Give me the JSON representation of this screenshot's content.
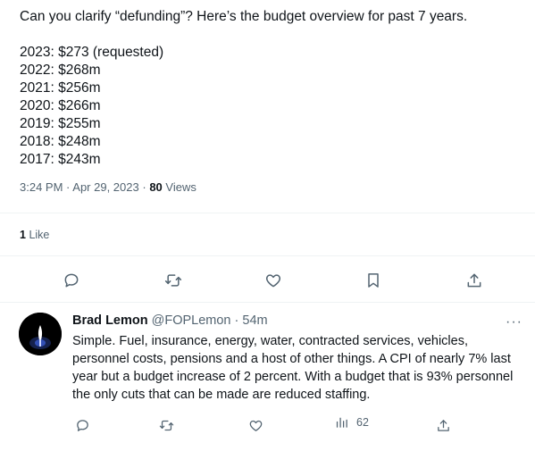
{
  "tweet": {
    "intro": "Can you clarify “defunding”? Here’s the budget overview for past 7 years.",
    "budget_lines": [
      "2023: $273 (requested)",
      "2022: $268m",
      "2021: $256m",
      "2020: $266m",
      "2019: $255m",
      "2018: $248m",
      "2017: $243m"
    ],
    "time": "3:24 PM",
    "date": "Apr 29, 2023",
    "views_count": "80",
    "views_label": "Views",
    "likes_count": "1",
    "likes_label": "Like"
  },
  "actions": [
    "reply-icon",
    "retweet-icon",
    "heart-icon",
    "bookmark-icon",
    "share-icon"
  ],
  "reply": {
    "name": "Brad Lemon",
    "handle": "@FOPLemon",
    "time": "54m",
    "more": "···",
    "text": "Simple. Fuel, insurance, energy, water, contracted services, vehicles, personnel costs, pensions and a host of other things. A CPI of nearly 7% last year but a budget increase of 2 percent. With a budget that is 93% personnel the only cuts that can be made are reduced staffing.",
    "views": "62"
  },
  "colors": {
    "text": "#0f1419",
    "muted": "#536471",
    "divider": "#eff3f4"
  }
}
